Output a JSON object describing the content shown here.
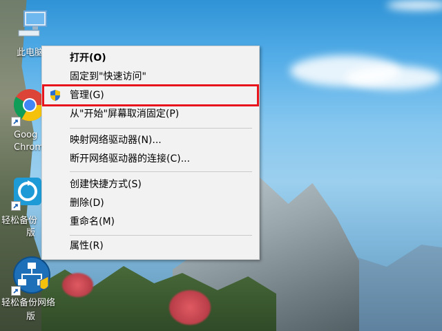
{
  "desktop": {
    "icons": [
      {
        "label": "此电脑"
      },
      {
        "label_lines": [
          "Goog",
          "Chrom"
        ]
      },
      {
        "label_lines": [
          "轻松备份",
          "版"
        ]
      },
      {
        "label_lines": [
          "轻松备份网络",
          "版"
        ]
      }
    ]
  },
  "context_menu": {
    "items": [
      {
        "label": "打开(O)",
        "bold": true
      },
      {
        "label": "固定到\"快速访问\""
      },
      {
        "label": "管理(G)",
        "icon": "uac-shield-icon",
        "highlighted": true
      },
      {
        "label": "从\"开始\"屏幕取消固定(P)"
      },
      {
        "label": "映射网络驱动器(N)..."
      },
      {
        "label": "断开网络驱动器的连接(C)..."
      },
      {
        "label": "创建快捷方式(S)"
      },
      {
        "label": "删除(D)"
      },
      {
        "label": "重命名(M)"
      },
      {
        "label": "属性(R)"
      }
    ],
    "highlight_color": "#e8141b"
  }
}
